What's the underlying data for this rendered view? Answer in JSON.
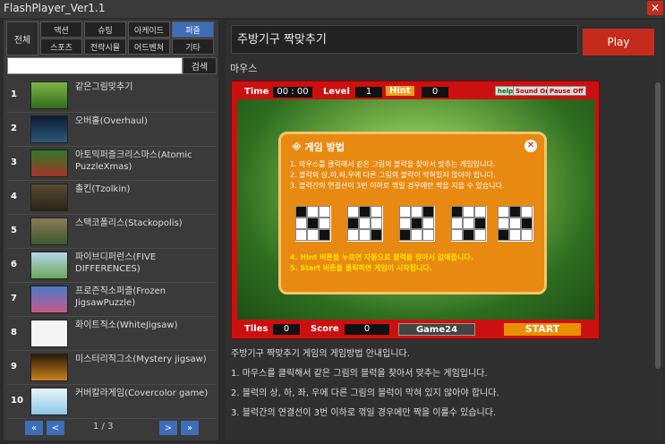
{
  "window": {
    "title": "FlashPlayer_Ver1.1",
    "close_icon": "close-icon"
  },
  "categories": {
    "all": "전체",
    "items": [
      "액션",
      "슈팅",
      "아케이드",
      "퍼즐",
      "스포츠",
      "전략시뮬",
      "어드벤쳐",
      "기타"
    ],
    "active": "퍼즐"
  },
  "search": {
    "placeholder": "",
    "button": "검색"
  },
  "games": [
    {
      "num": "1",
      "name": "같은그림맞추기"
    },
    {
      "num": "2",
      "name": "오버홀(Overhaul)"
    },
    {
      "num": "3",
      "name": "아토믹퍼즐크리스마스(Atomic PuzzleXmas)"
    },
    {
      "num": "4",
      "name": "촐킨(Tzolkin)"
    },
    {
      "num": "5",
      "name": "스택코폴리스(Stackopolis)"
    },
    {
      "num": "6",
      "name": "파이브디퍼런스(FIVE DIFFERENCES)"
    },
    {
      "num": "7",
      "name": "프로즌직소퍼즐(Frozen JigsawPuzzle)"
    },
    {
      "num": "8",
      "name": "화이트직소(WhiteJigsaw)"
    },
    {
      "num": "9",
      "name": "미스터리직그소(Mystery jigsaw)"
    },
    {
      "num": "10",
      "name": "커버칼라게임(Covercolor game)"
    }
  ],
  "pager": {
    "first": "«",
    "prev": "<",
    "info": "1 / 3",
    "next": ">",
    "last": "»"
  },
  "detail": {
    "title": "주방기구 짝맞추기",
    "play": "Play",
    "input_label": "마우스",
    "game": {
      "time_label": "Time",
      "time": "00 : 00",
      "level_label": "Level",
      "level": "1",
      "hint_label": "Hint",
      "hint": "0",
      "help": "help",
      "sound": "Sound On",
      "pause": "Pause Off",
      "tiles_label": "Tiles",
      "tiles": "0",
      "score_label": "Score",
      "score": "0",
      "logo": "Game24",
      "start": "START",
      "dialog_title": "※ 게임 방법",
      "dialog_lines": [
        "1. 마우스를 클릭해서 같은 그림의 블럭을 찾아서 맞추는 게임입니다.",
        "2. 블럭의 상,하,좌,우에 다른 그림의 블럭이 막혀있지 않아야 합니다.",
        "3. 블럭간의 연결선이 3번 이하로 꺾일 경우에만 짝을 지을 수 있습니다.",
        "4. Hint 버튼을 누르면 자동으로 블럭을 찾아서 없애줍니다.",
        "5. Start 버튼을 클릭하면 게임이 시작됩니다."
      ]
    },
    "description": [
      "주방기구 짝맞추기 게임의 게임방법 안내입니다.",
      "1. 마우스를 클릭해서 같은 그림의 블럭을 찾아서 맞추는 게임입니다.",
      "2. 블럭의 상, 하, 좌, 우에 다른 그림의 블럭이 막혀 있지 않아야 합니다.",
      "3. 블럭간의 연결선이 3번 이하로 꺾일 경우에만 짝을 이룰수 있습니다."
    ]
  }
}
